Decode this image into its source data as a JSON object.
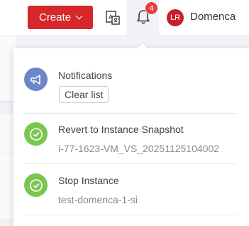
{
  "header": {
    "create_label": "Create",
    "notification_count": "4",
    "avatar_initials": "LR",
    "username": "Domenca"
  },
  "notifications": {
    "title": "Notifications",
    "clear_label": "Clear list",
    "items": [
      {
        "title": "Revert to Instance Snapshot",
        "subtitle": "i-77-1623-VM_VS_20251125104002",
        "status": "success"
      },
      {
        "title": "Stop Instance",
        "subtitle": "test-domenca-1-si",
        "status": "success"
      }
    ]
  },
  "colors": {
    "brand_red": "#d6282b",
    "notification_icon_bg": "#6b86c9",
    "success_green": "#7ac74f"
  }
}
